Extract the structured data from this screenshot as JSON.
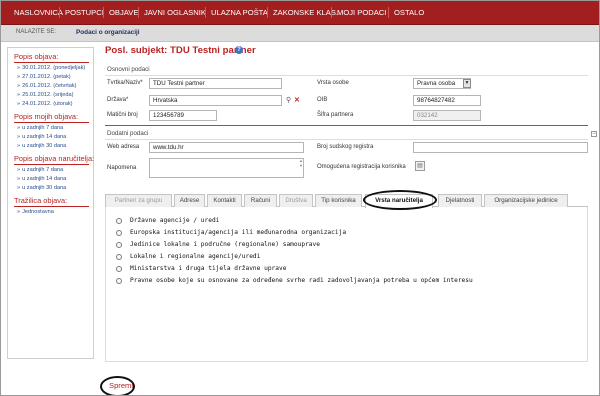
{
  "nav": {
    "items": [
      "NASLOVNICA",
      "POSTUPCI",
      "OBJAVE",
      "JAVNI OGLASNIK",
      "ULAZNA POŠTA",
      "ZAKONSKE KLAS.",
      "MOJI PODACI",
      "OSTALO"
    ]
  },
  "breadcrumb": {
    "label": "NALAZITE SE:",
    "current": "Podaci o organizaciji"
  },
  "sidebar": {
    "sections": [
      {
        "title": "Popis objava:",
        "items": [
          "30.01.2012. (ponedjeljak)",
          "27.01.2012. (petak)",
          "26.01.2012. (četvrtak)",
          "25.01.2012. (srijeda)",
          "24.01.2012. (utorak)"
        ]
      },
      {
        "title": "Popis mojih objava:",
        "items": [
          "u zadnjih 7 dana",
          "u zadnjih 14 dana",
          "u zadnjih 30 dana"
        ]
      },
      {
        "title": "Popis objava naručitelja:",
        "items": [
          "u zadnjih 7 dana",
          "u zadnjih 14 dana",
          "u zadnjih 30 dana"
        ]
      },
      {
        "title": "Tražilica objava:",
        "items": [
          "Jednostavna"
        ]
      }
    ]
  },
  "page": {
    "title": "Posl. subjekt: TDU Testni partner",
    "help_icon": "question-circle-icon"
  },
  "basic": {
    "section_title": "Osnovni podaci",
    "company_label": "Tvrtka/Naziv*",
    "company_value": "TDU Testni partner",
    "country_label": "Država*",
    "country_value": "Hrvatska",
    "id_label": "Matični broj",
    "id_value": "123456789",
    "type_label": "Vrsta osobe",
    "type_value": "Pravna osoba",
    "oib_label": "OIB",
    "oib_value": "98764827482",
    "partner_code_label": "Šifra partnera",
    "partner_code_value": "032142"
  },
  "extra": {
    "section_title": "Dodatni podaci",
    "web_label": "Web adresa",
    "web_value": "www.tdu.hr",
    "note_label": "Napomena",
    "note_value": "",
    "court_label": "Broj sudskog registra",
    "court_value": "",
    "users_label": "Omogućena registracija korisnika"
  },
  "tabs": [
    "Partneri za grupu",
    "Adrese",
    "Kontakti",
    "Računi",
    "Društva",
    "Tip korisnika",
    "Vrsta naručitelja",
    "Djelatnosti",
    "Organizacijske jedinice"
  ],
  "options": [
    "Državne agencije / uredi",
    "Europska institucija/agencija ili međunarodna organizacija",
    "Jedinice lokalne i područne (regionalne) samouprave",
    "Lokalne i regionalne agencije/uredi",
    "Ministarstva i druga tijela državne uprave",
    "Pravne osobe koje su osnovane za određene svrhe radi zadovoljavanja potreba u općem interesu"
  ],
  "save_label": "Spremi",
  "colors": {
    "brand_red": "#a31f1f",
    "heading_red": "#bb2222",
    "link_blue": "#2a4d8a"
  }
}
